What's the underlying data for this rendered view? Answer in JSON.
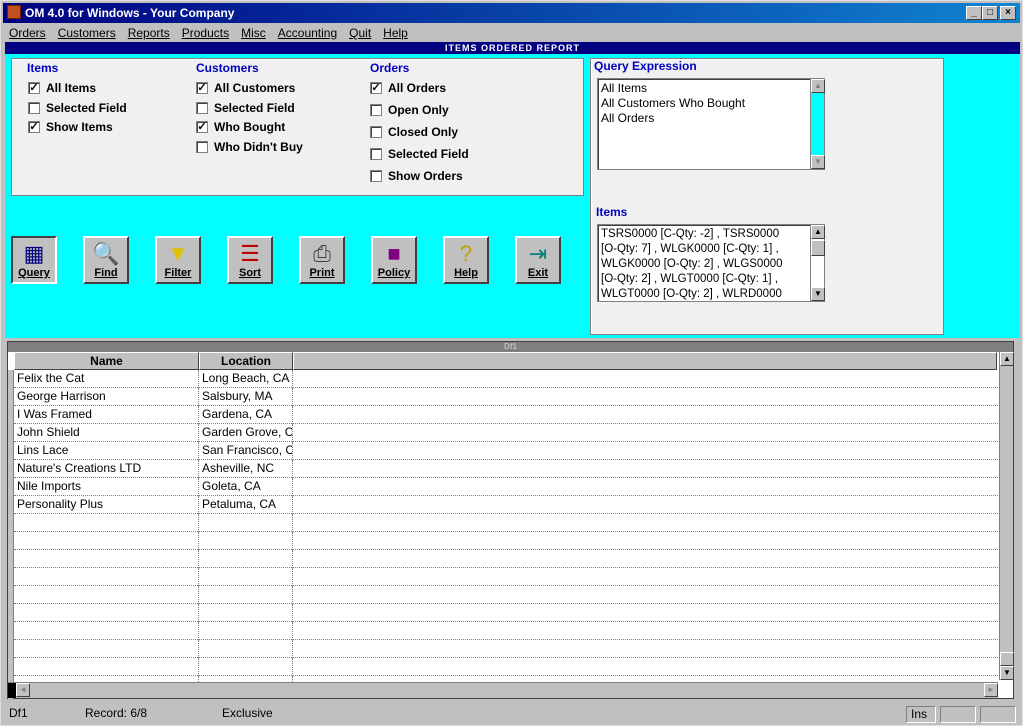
{
  "window": {
    "title": "OM 4.0 for Windows - Your Company",
    "min": "_",
    "max": "□",
    "close": "×"
  },
  "menu": [
    "Orders",
    "Customers",
    "Reports",
    "Products",
    "Misc",
    "Accounting",
    "Quit",
    "Help"
  ],
  "report_title": "ITEMS ORDERED REPORT",
  "items_group": {
    "title": "Items",
    "options": [
      {
        "label": "All Items",
        "checked": true
      },
      {
        "label": "Selected Field",
        "checked": false
      },
      {
        "label": "Show Items",
        "checked": true
      }
    ]
  },
  "customers_group": {
    "title": "Customers",
    "options": [
      {
        "label": "All Customers",
        "checked": true
      },
      {
        "label": "Selected Field",
        "checked": false
      },
      {
        "label": "Who Bought",
        "checked": true
      },
      {
        "label": "Who Didn't Buy",
        "checked": false
      }
    ]
  },
  "orders_group": {
    "title": "Orders",
    "options": [
      {
        "label": "All Orders",
        "checked": true
      },
      {
        "label": "Open Only",
        "checked": false
      },
      {
        "label": "Closed Only",
        "checked": false
      },
      {
        "label": "Selected Field",
        "checked": false
      },
      {
        "label": "Show Orders",
        "checked": false
      }
    ]
  },
  "query_expression": {
    "title": "Query Expression",
    "lines": [
      "All Items",
      "All Customers Who Bought",
      "All Orders"
    ]
  },
  "items_box": {
    "title": "Items",
    "lines": [
      "TSRS0000 [C-Qty: -2] , TSRS0000",
      "[O-Qty: 7] , WLGK0000 [C-Qty: 1] ,",
      "WLGK0000 [O-Qty: 2] , WLGS0000",
      "[O-Qty: 2] , WLGT0000 [C-Qty: 1] ,",
      "WLGT0000 [O-Qty: 2] , WLRD0000"
    ]
  },
  "toolbar": [
    {
      "label": "Query",
      "icon": "query-icon",
      "glyph": "▦",
      "color": "#000080"
    },
    {
      "label": "Find",
      "icon": "find-icon",
      "glyph": "🔍",
      "color": "#000080"
    },
    {
      "label": "Filter",
      "icon": "filter-icon",
      "glyph": "▼",
      "color": "#e0c000"
    },
    {
      "label": "Sort",
      "icon": "sort-icon",
      "glyph": "☰",
      "color": "#c00000"
    },
    {
      "label": "Print",
      "icon": "print-icon",
      "glyph": "⎙",
      "color": "#404040"
    },
    {
      "label": "Policy",
      "icon": "policy-icon",
      "glyph": "■",
      "color": "#800080"
    },
    {
      "label": "Help",
      "icon": "help-icon",
      "glyph": "?",
      "color": "#c0a000"
    },
    {
      "label": "Exit",
      "icon": "exit-icon",
      "glyph": "⇥",
      "color": "#008080"
    }
  ],
  "grid": {
    "title": "Df1",
    "columns": [
      "Name",
      "Location"
    ],
    "rows": [
      [
        "Felix the Cat",
        "Long Beach, CA"
      ],
      [
        "George Harrison",
        "Salsbury, MA"
      ],
      [
        "I Was Framed",
        "Gardena, CA"
      ],
      [
        "John Shield",
        "Garden Grove, C"
      ],
      [
        "Lins Lace",
        "San Francisco, C"
      ],
      [
        "Nature's Creations LTD",
        "Asheville, NC"
      ],
      [
        "Nile Imports",
        "Goleta, CA"
      ],
      [
        "Personality Plus",
        "Petaluma, CA"
      ]
    ],
    "empty_rows": 10
  },
  "status": {
    "form": "Df1",
    "record": "Record: 6/8",
    "mode": "Exclusive",
    "ins": "Ins"
  }
}
